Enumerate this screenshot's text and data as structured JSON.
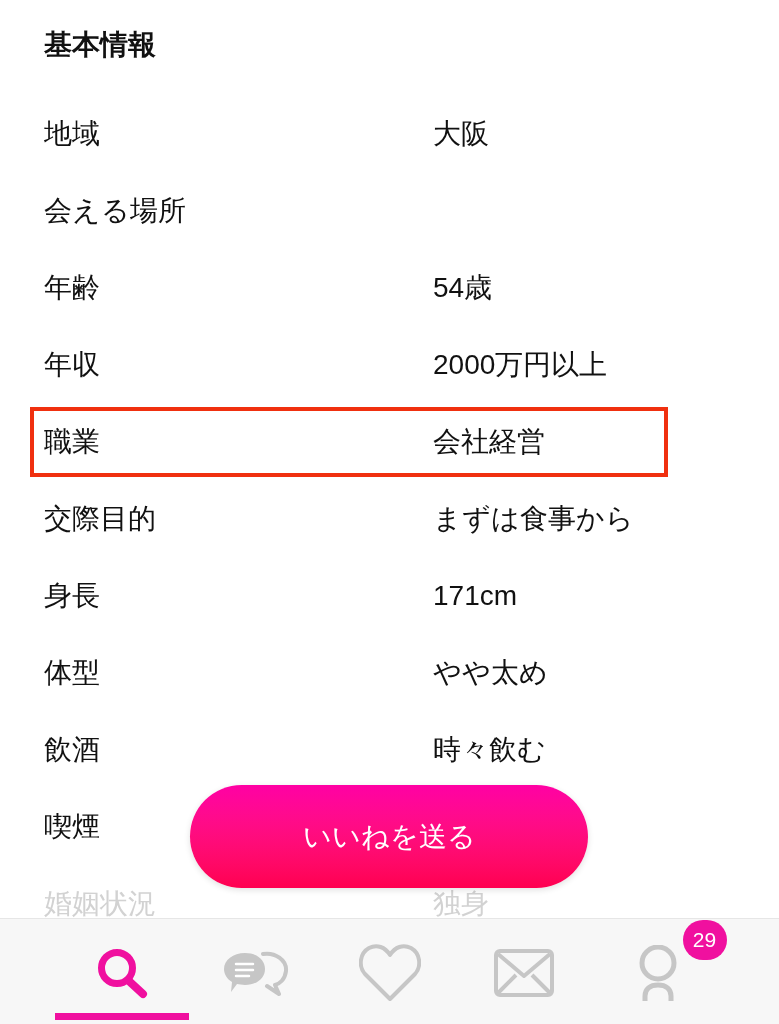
{
  "section_title": "基本情報",
  "rows": [
    {
      "label": "地域",
      "value": "大阪",
      "highlighted": false,
      "faded": false
    },
    {
      "label": "会える場所",
      "highlighted": false,
      "faded": false
    },
    {
      "label": "年齢",
      "value": "54歳",
      "highlighted": false,
      "faded": false
    },
    {
      "label": "年収",
      "value": "2000万円以上",
      "highlighted": false,
      "faded": false
    },
    {
      "label": "職業",
      "value": "会社経営",
      "highlighted": true,
      "faded": false
    },
    {
      "label": "交際目的",
      "value": "まずは食事から",
      "highlighted": false,
      "faded": false
    },
    {
      "label": "身長",
      "value": "171cm",
      "highlighted": false,
      "faded": false
    },
    {
      "label": "体型",
      "value": "やや太め",
      "highlighted": false,
      "faded": false
    },
    {
      "label": "飲酒",
      "value": "時々飲む",
      "highlighted": false,
      "faded": false
    },
    {
      "label": "喫煙",
      "highlighted": false,
      "faded": false
    },
    {
      "label": "婚姻状況",
      "value": "独身",
      "highlighted": false,
      "faded": true
    }
  ],
  "like_button": {
    "label": "いいねを送る"
  },
  "nav": [
    {
      "kind": "search",
      "selected": true
    },
    {
      "kind": "chat",
      "selected": false
    },
    {
      "kind": "like",
      "selected": false
    },
    {
      "kind": "mail",
      "selected": false
    },
    {
      "kind": "profile",
      "selected": false,
      "badge": "29"
    }
  ]
}
